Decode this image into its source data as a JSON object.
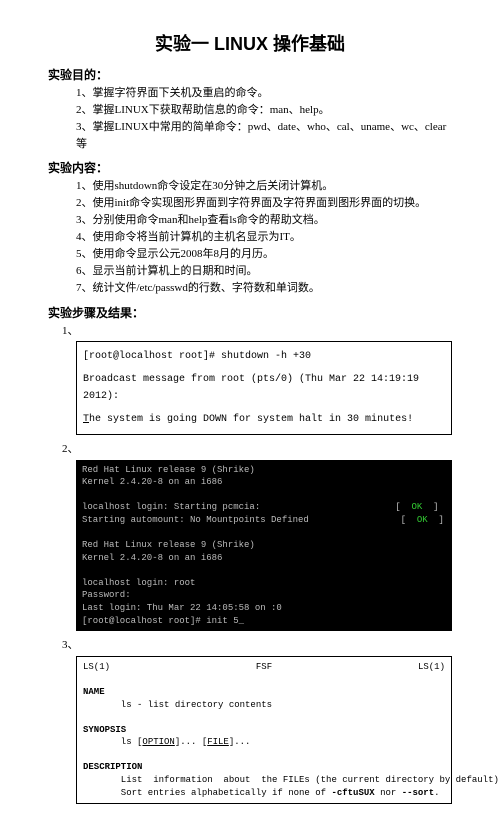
{
  "title": "实验一  LINUX 操作基础",
  "sections": {
    "purpose": {
      "heading": "实验目的：",
      "items": [
        "1、掌握字符界面下关机及重启的命令。",
        "2、掌握LINUX下获取帮助信息的命令：man、help。",
        "3、掌握LINUX中常用的简单命令：pwd、date、who、cal、uname、wc、clear等"
      ]
    },
    "content": {
      "heading": "实验内容：",
      "items": [
        "1、使用shutdown命令设定在30分钟之后关闭计算机。",
        "2、使用init命令实现图形界面到字符界面及字符界面到图形界面的切换。",
        "3、分别使用命令man和help查看ls命令的帮助文档。",
        "4、使用命令将当前计算机的主机名显示为IT。",
        "5、使用命令显示公元2008年8月的月历。",
        "6、显示当前计算机上的日期和时间。",
        "7、统计文件/etc/passwd的行数、字符数和单词数。"
      ]
    },
    "steps": {
      "heading": "实验步骤及结果：",
      "num1": "1、",
      "num2": "2、",
      "num3": "3、"
    }
  },
  "terminal1": {
    "line1": "[root@localhost root]# shutdown -h +30",
    "line2": "Broadcast message from root (pts/0) (Thu Mar 22 14:19:19 2012):",
    "line3_a": "T",
    "line3_b": "he system is going DOWN for system halt in 30 minutes!"
  },
  "terminal2": {
    "l1": "Red Hat Linux release 9 (Shrike)",
    "l2": "Kernel 2.4.20-8 on an i686",
    "l3a": "localhost login: Starting pcmcia:",
    "l3b": "[  ",
    "l3ok": "OK",
    "l3c": "  ]",
    "l4a": "Starting automount: No Mountpoints Defined",
    "l5": "Red Hat Linux release 9 (Shrike)",
    "l6": "Kernel 2.4.20-8 on an i686",
    "l7": "localhost login: root",
    "l8": "Password:",
    "l9": "Last login: Thu Mar 22 14:05:58 on :0",
    "l10": "[root@localhost root]# init 5_"
  },
  "manpage": {
    "hdr_l": "LS(1)",
    "hdr_c": "FSF",
    "hdr_r": "LS(1)",
    "name_h": "NAME",
    "name_b": "       ls - list directory contents",
    "syn_h": "SYNOPSIS",
    "syn_pre": "       ls [",
    "syn_opt": "OPTION",
    "syn_mid": "]... [",
    "syn_file": "FILE",
    "syn_end": "]...",
    "desc_h": "DESCRIPTION",
    "desc_l1": "       List  information  about  the FILEs (the current directory by default).",
    "desc_l2_a": "       Sort entries alphabetically if none of ",
    "desc_l2_b": "-cftuSUX",
    "desc_l2_c": " nor ",
    "desc_l2_d": "--sort",
    "desc_l2_e": "."
  }
}
